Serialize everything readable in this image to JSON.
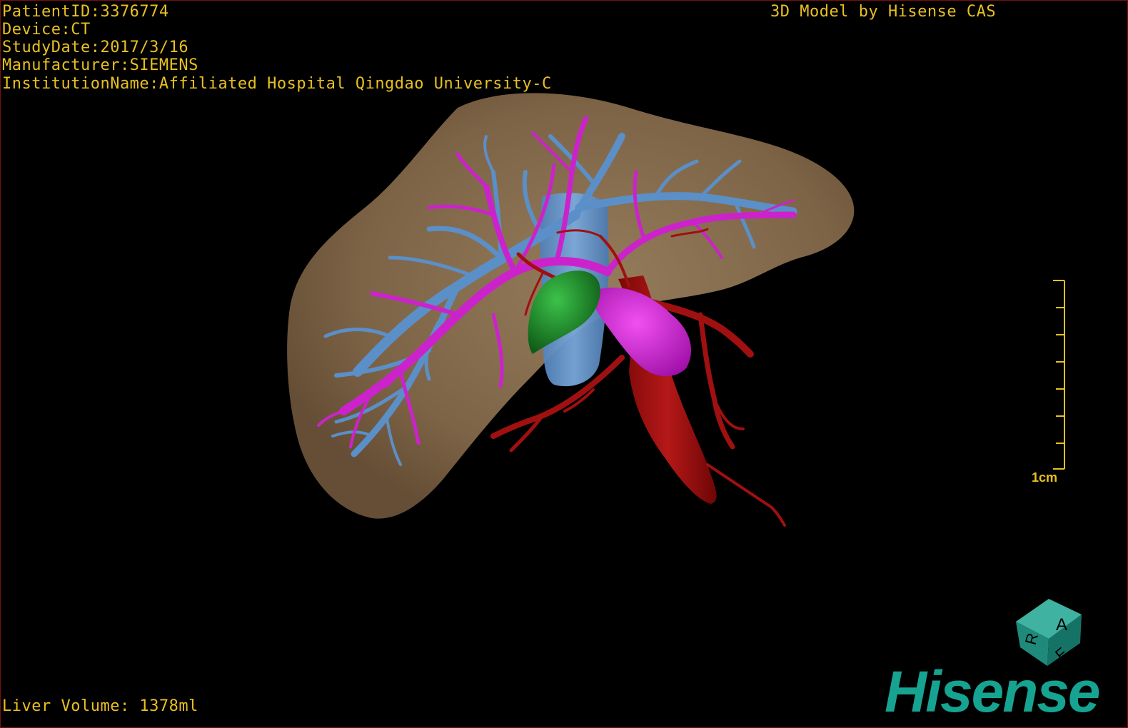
{
  "patient": {
    "id_line": "PatientID:3376774",
    "device_line": "Device:CT",
    "study_date_line": "StudyDate:2017/3/16",
    "manufacturer_line": "Manufacturer:SIEMENS",
    "institution_line": "InstitutionName:Affiliated Hospital Qingdao University-C"
  },
  "brand_text": "3D Model by Hisense CAS",
  "volume_text": "Liver Volume: 1378ml",
  "scale_bar": {
    "label": "1cm"
  },
  "orientation_cube": {
    "labels": [
      "A",
      "R",
      "F"
    ]
  },
  "logo_text": "Hisense",
  "colors": {
    "overlay_text": "#e8c020",
    "liver": "#8a7050",
    "portal_vein": "#cc22cc",
    "hepatic_vein": "#5b8fc8",
    "artery": "#a01010",
    "gallbladder": "#1e8a2a",
    "logo": "#17a391"
  },
  "icons": {
    "orientation_cube": "orientation-cube-icon",
    "scale_bar": "scale-bar-icon"
  }
}
